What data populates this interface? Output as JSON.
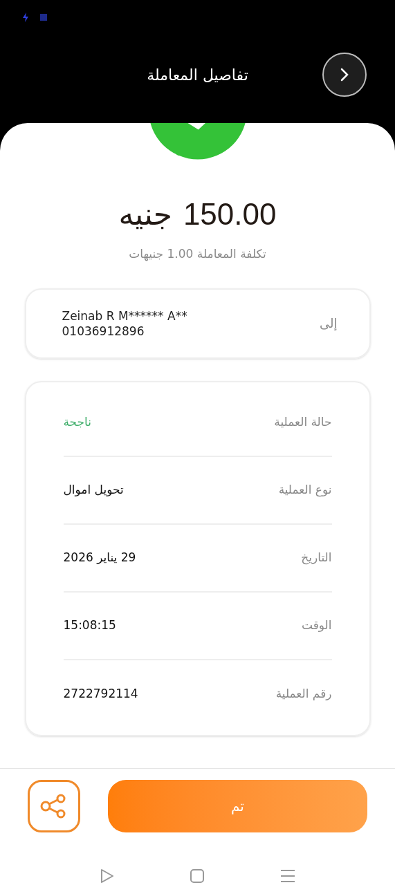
{
  "header": {
    "title": "تفاصيل المعاملة"
  },
  "amount": {
    "value": "150.00",
    "currency": "جنيه",
    "fee": "تكلفة المعاملة 1.00 جنيهات"
  },
  "recipient": {
    "label": "إلى",
    "name": "Zeinab R M****** A**",
    "phone": "01036912896"
  },
  "details": [
    {
      "label": "حالة العملية",
      "value": "ناجحة",
      "kind": "status"
    },
    {
      "label": "نوع العملية",
      "value": "تحويل اموال",
      "kind": "plain"
    },
    {
      "label": "التاريخ",
      "value": "29 يناير 2026",
      "kind": "plain"
    },
    {
      "label": "الوقت",
      "value": "15:08:15",
      "kind": "plain"
    },
    {
      "label": "رقم العملية",
      "value": "2722792114",
      "kind": "plain"
    }
  ],
  "done_button": "تم"
}
